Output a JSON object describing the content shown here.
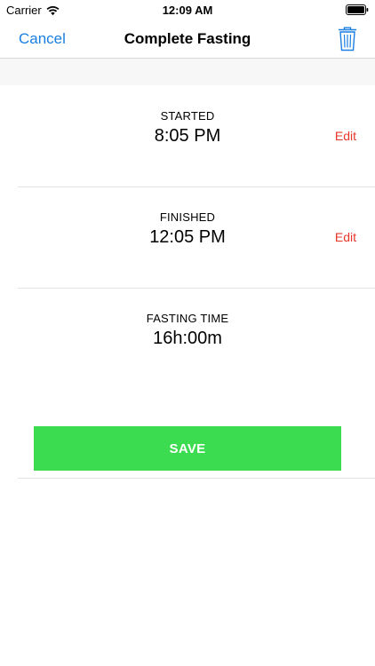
{
  "status_bar": {
    "carrier": "Carrier",
    "time": "12:09 AM"
  },
  "nav": {
    "cancel_label": "Cancel",
    "title": "Complete Fasting",
    "trash_icon": "trash-icon"
  },
  "started": {
    "label": "STARTED",
    "value": "8:05 PM",
    "edit_label": "Edit"
  },
  "finished": {
    "label": "FINISHED",
    "value": "12:05 PM",
    "edit_label": "Edit"
  },
  "fasting_time": {
    "label": "FASTING TIME",
    "value": "16h:00m"
  },
  "save_label": "SAVE",
  "colors": {
    "accent_blue": "#1a7fe0",
    "edit_red": "#e8352a",
    "save_green": "#3cdc51"
  }
}
